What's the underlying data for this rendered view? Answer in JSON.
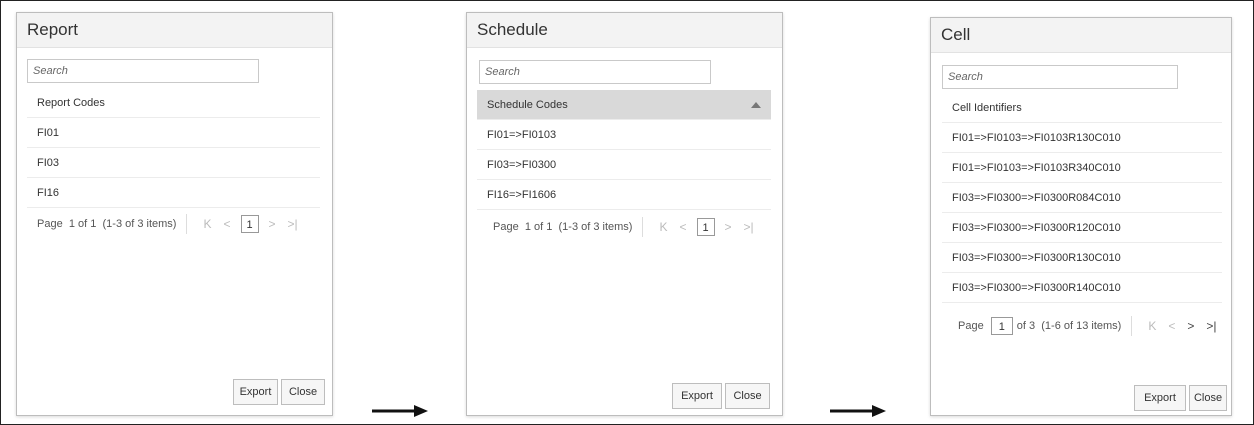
{
  "report": {
    "title": "Report",
    "search_placeholder": "Search",
    "column_header": "Report Codes",
    "rows": [
      "FI01",
      "FI03",
      "FI16"
    ],
    "pager": {
      "page_label": "Page",
      "page": "1",
      "of_label": "of 1",
      "items": "(1-3 of 3 items)"
    },
    "export_label": "Export",
    "close_label": "Close"
  },
  "schedule": {
    "title": "Schedule",
    "search_placeholder": "Search",
    "column_header": "Schedule Codes",
    "rows": [
      "FI01=>FI0103",
      "FI03=>FI0300",
      "FI16=>FI1606"
    ],
    "pager": {
      "page_label": "Page",
      "page": "1",
      "of_label": "of 1",
      "items": "(1-3 of 3 items)"
    },
    "export_label": "Export",
    "close_label": "Close"
  },
  "cell": {
    "title": "Cell",
    "search_placeholder": "Search",
    "column_header": "Cell Identifiers",
    "rows": [
      "FI01=>FI0103=>FI0103R130C010",
      "FI01=>FI0103=>FI0103R340C010",
      "FI03=>FI0300=>FI0300R084C010",
      "FI03=>FI0300=>FI0300R120C010",
      "FI03=>FI0300=>FI0300R130C010",
      "FI03=>FI0300=>FI0300R140C010"
    ],
    "pager": {
      "page_label": "Page",
      "page": "1",
      "of_label": "of 3",
      "items": "(1-6 of 13 items)"
    },
    "export_label": "Export",
    "close_label": "Close"
  },
  "icons": {
    "first": "first-page-icon",
    "prev": "previous-page-icon",
    "next": "next-page-icon",
    "last": "last-page-icon",
    "sort": "sort-ascending-icon",
    "flow_arrow": "right-arrow-icon"
  },
  "colors": {
    "header_bg": "#f3f3f3",
    "selected_header_bg": "#d9d9d9",
    "border": "#bdbdbd"
  }
}
